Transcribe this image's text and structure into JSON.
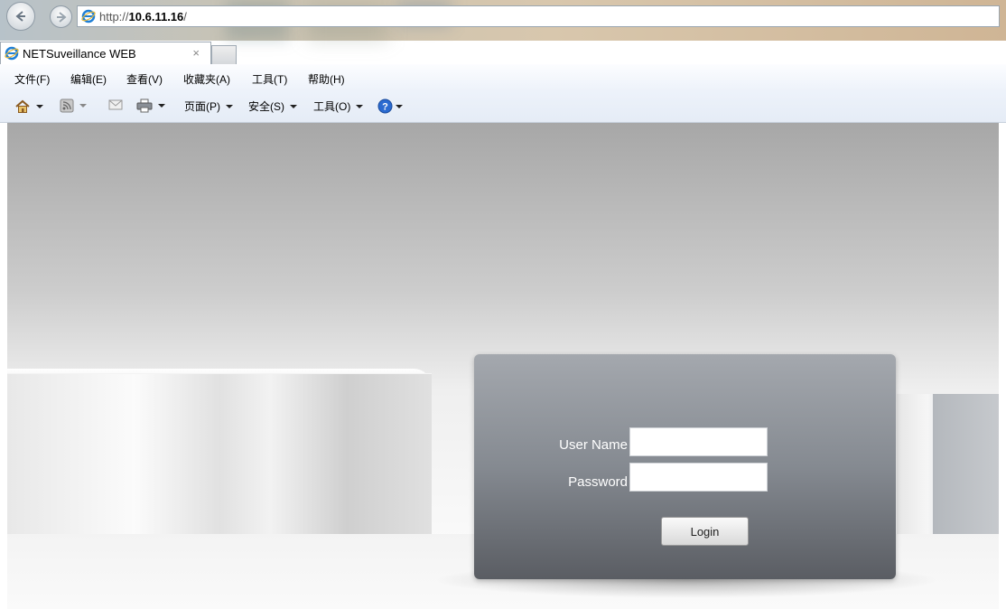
{
  "browser": {
    "address": {
      "prefix": "http://",
      "host": "10.6.11.16",
      "suffix": "/"
    },
    "tab": {
      "title": "NETSuveillance WEB",
      "close": "×"
    },
    "menu": [
      {
        "label": "文件(F)"
      },
      {
        "label": "编辑(E)"
      },
      {
        "label": "查看(V)"
      },
      {
        "label": "收藏夹(A)"
      },
      {
        "label": "工具(T)"
      },
      {
        "label": "帮助(H)"
      }
    ],
    "command_bar": {
      "page_label": "页面(P)",
      "safety_label": "安全(S)",
      "tools_label": "工具(O)"
    }
  },
  "login": {
    "username_label": "User Name",
    "password_label": "Password",
    "username_value": "",
    "password_value": "",
    "login_button": "Login"
  },
  "colors": {
    "panel_top": "#a4a8ae",
    "panel_bottom": "#5a5d63",
    "ie_blue": "#1f7fd6"
  }
}
